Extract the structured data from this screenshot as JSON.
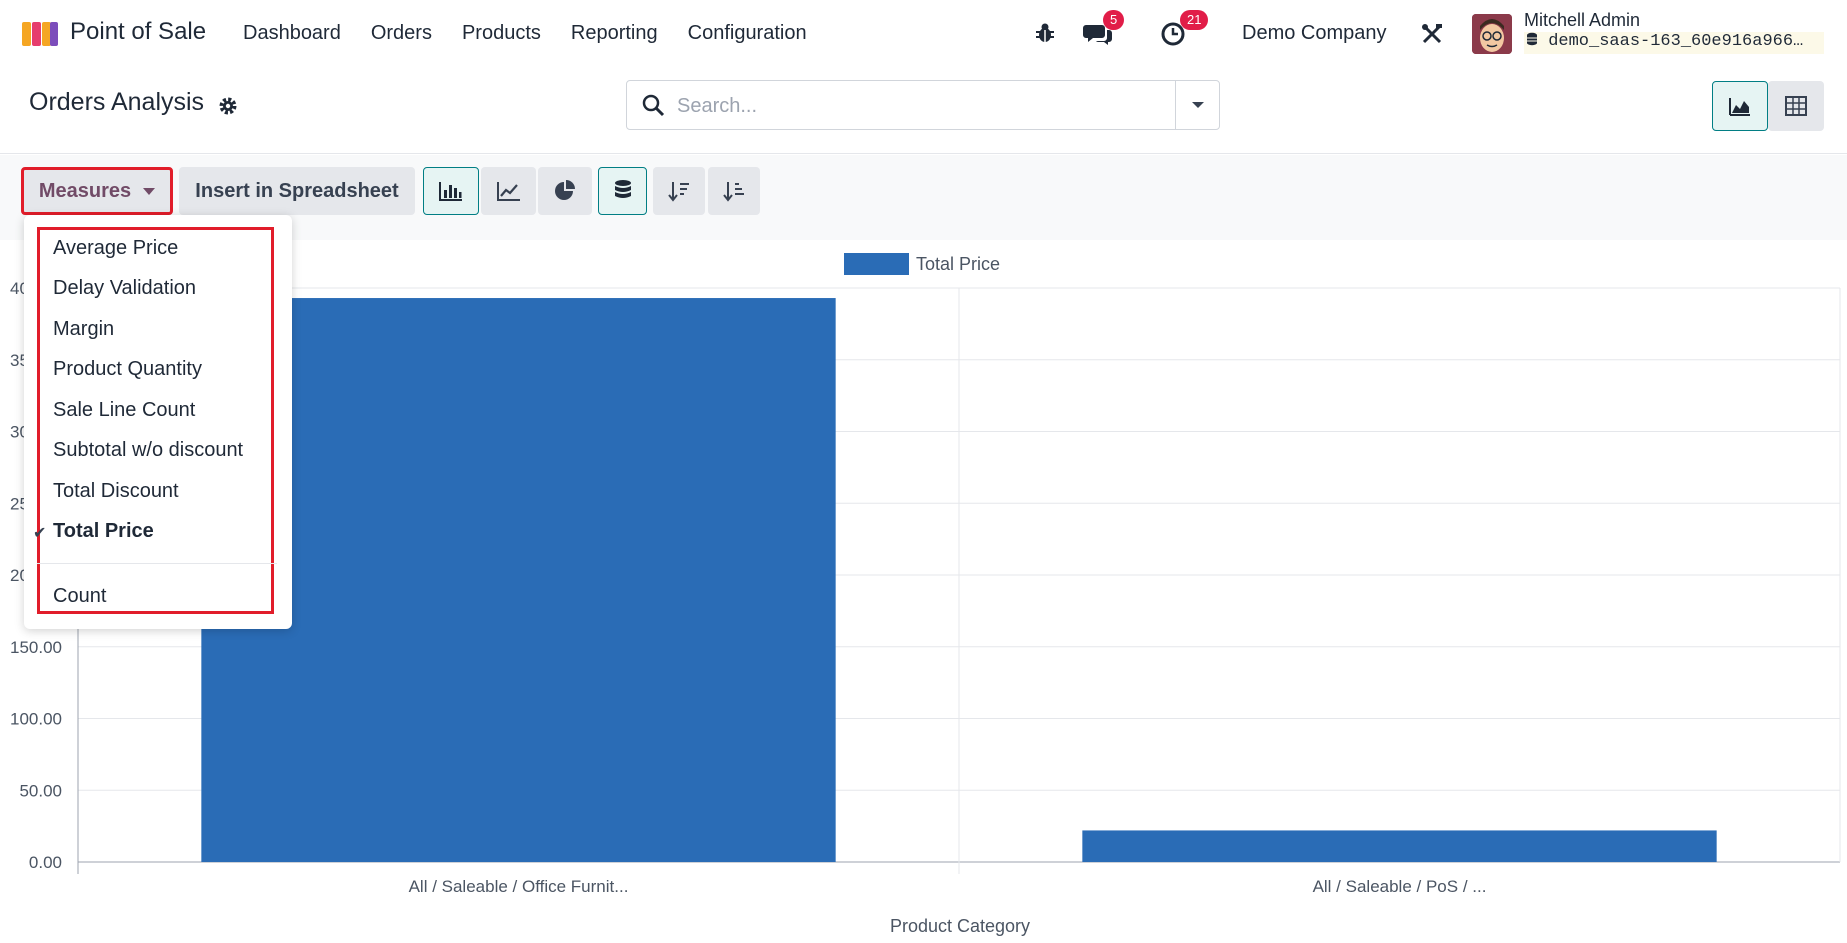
{
  "navbar": {
    "app_name": "Point of Sale",
    "menu": [
      "Dashboard",
      "Orders",
      "Products",
      "Reporting",
      "Configuration"
    ],
    "messages_badge": "5",
    "activities_badge": "21",
    "company": "Demo Company",
    "user_name": "Mitchell Admin",
    "database": "demo_saas-163_60e916a966…"
  },
  "control": {
    "title": "Orders Analysis",
    "search_placeholder": "Search..."
  },
  "toolbar": {
    "measures_label": "Measures",
    "spreadsheet_label": "Insert in Spreadsheet"
  },
  "measures_menu": {
    "items": [
      "Average Price",
      "Delay Validation",
      "Margin",
      "Product Quantity",
      "Sale Line Count",
      "Subtotal w/o discount",
      "Total Discount",
      "Total Price"
    ],
    "selected": "Total Price",
    "count_label": "Count"
  },
  "chart_data": {
    "type": "bar",
    "categories": [
      "All / Saleable / Office Furnit...",
      "All / Saleable / PoS / ..."
    ],
    "series": [
      {
        "name": "Total Price",
        "values": [
          393,
          22
        ]
      }
    ],
    "xlabel": "Product Category",
    "ylabel": "",
    "ylim": [
      0,
      400
    ],
    "y_ticks": [
      "0.00",
      "50.00",
      "100.00",
      "150.00",
      "200.00",
      "250.00",
      "300.00",
      "350.00",
      "400.00"
    ],
    "legend": "top-center",
    "grid": true,
    "color": "#2a6cb6"
  }
}
